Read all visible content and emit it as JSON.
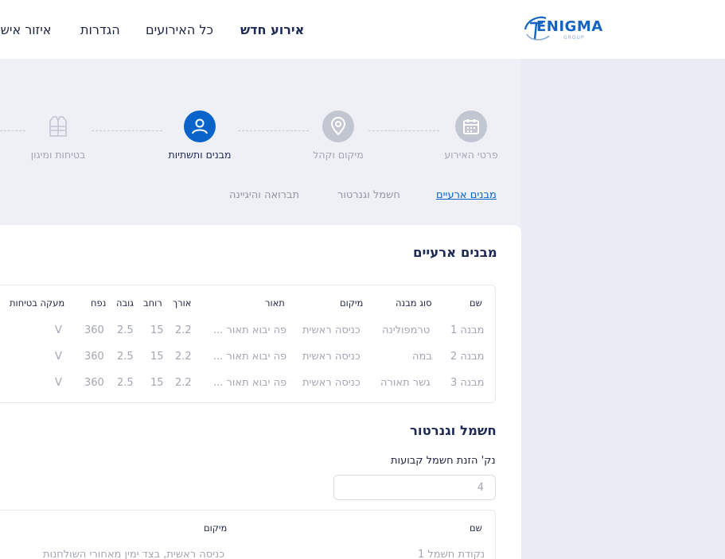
{
  "nav": {
    "new_event": "אירוע חדש",
    "all_events": "כל האירועים",
    "settings": "הגדרות",
    "personal_area": "איזור אישי"
  },
  "logo": {
    "text": "ENIGMA",
    "sub": "GROUP"
  },
  "steps": [
    {
      "label": "פרטי האירוע",
      "icon": "calendar-icon",
      "state": "inactive"
    },
    {
      "label": "מיקום וקהל",
      "icon": "location-pin-icon",
      "state": "inactive"
    },
    {
      "label": "מבנים ותשתיות",
      "icon": "user-icon",
      "state": "active"
    },
    {
      "label": "בטיחות ומיגון",
      "icon": "safety-vest-icon",
      "state": "inactive"
    }
  ],
  "subtabs": [
    {
      "label": "מבנים ארעיים",
      "active": true
    },
    {
      "label": "חשמל וגנרטור",
      "active": false
    },
    {
      "label": "תברואה והיגיינה",
      "active": false
    }
  ],
  "structures": {
    "title": "מבנים ארעיים",
    "headers": {
      "name": "שם",
      "type": "סוג מבנה",
      "location": "מיקום",
      "description": "תאור",
      "length": "אורך",
      "width": "רוחב",
      "height": "גובה",
      "volume": "נפח",
      "safety_rail": "מעקה בטיחות"
    },
    "rows": [
      {
        "name": "מבנה 1",
        "type": "טרמפולינה",
        "location": "כניסה ראשית",
        "description": "פה יבוא תאור ...",
        "length": "2.2",
        "width": "15",
        "height": "2.5",
        "volume": "360",
        "safety_rail": "V"
      },
      {
        "name": "מבנה 2",
        "type": "במה",
        "location": "כניסה ראשית",
        "description": "פה יבוא תאור ...",
        "length": "2.2",
        "width": "15",
        "height": "2.5",
        "volume": "360",
        "safety_rail": "V"
      },
      {
        "name": "מבנה 3",
        "type": "גשר תאורה",
        "location": "כניסה ראשית",
        "description": "פה יבוא תאור ...",
        "length": "2.2",
        "width": "15",
        "height": "2.5",
        "volume": "360",
        "safety_rail": "V"
      }
    ]
  },
  "electric": {
    "title": "חשמל וגנרטור",
    "points_label": "נק' הזנת חשמל קבועות",
    "points_value": "4",
    "headers": {
      "name": "שם",
      "location": "מיקום"
    },
    "rows": [
      {
        "name": "נקודת חשמל 1",
        "location": "כניסה ראשית, בצד ימין מאחורי השולחנות"
      }
    ]
  },
  "colors": {
    "primary": "#0a63c9",
    "navy": "#1e2a55",
    "muted": "#a3a7b3"
  }
}
